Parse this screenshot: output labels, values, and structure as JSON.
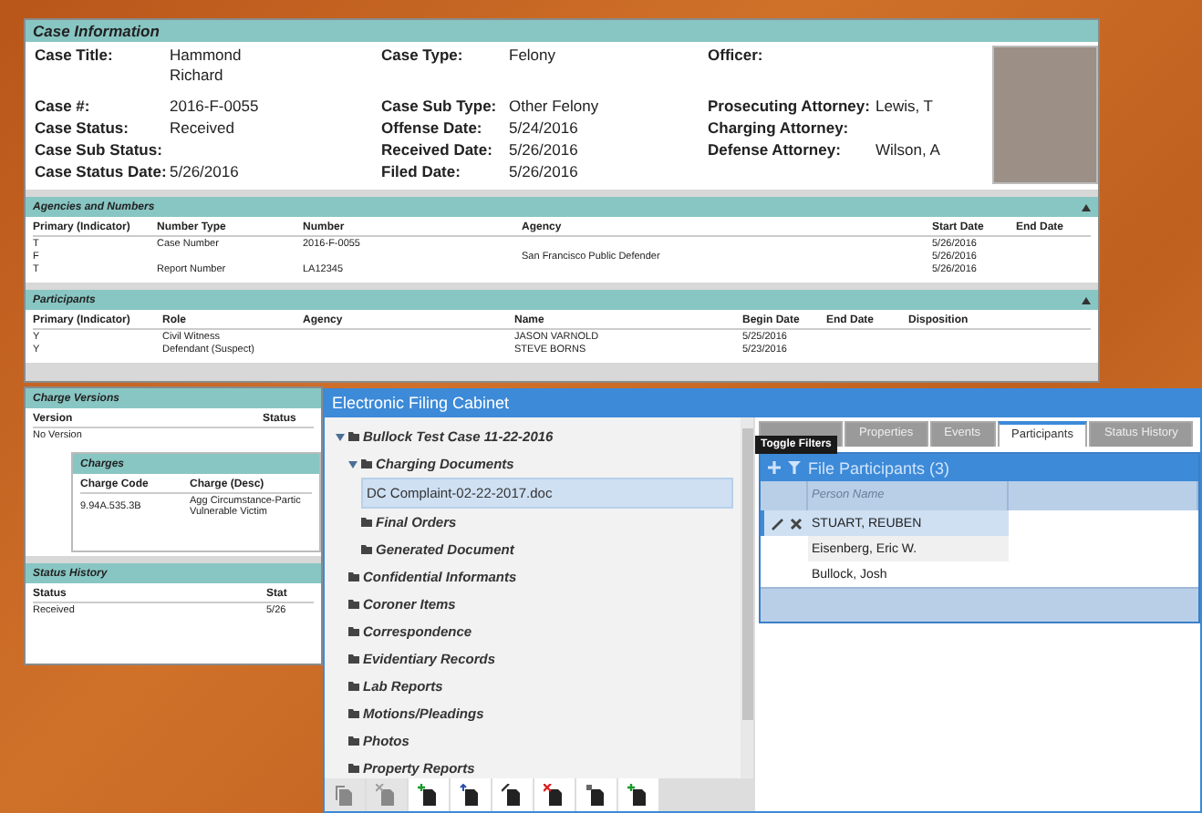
{
  "case_window": {
    "title": "Case Information",
    "fields": [
      [
        {
          "label": "Case Title:",
          "value": "Hammond\nRichard"
        },
        {
          "label": "Case Type:",
          "value": "Felony"
        },
        {
          "label": "Officer:"
        }
      ],
      [
        {
          "label": "Case #:",
          "value": "2016-F-0055"
        },
        {
          "label": "Case Sub Type:",
          "value": "Other Felony"
        },
        {
          "label": "Prosecuting Attorney:",
          "value": "Lewis, T"
        }
      ],
      [
        {
          "label": "Case Status:",
          "value": "Received"
        },
        {
          "label": "Offense Date:",
          "value": "5/24/2016"
        },
        {
          "label": "Charging Attorney:"
        }
      ],
      [
        {
          "label": "Case Sub Status:"
        },
        {
          "label": "Received Date:",
          "value": "5/26/2016"
        },
        {
          "label": "Defense Attorney:",
          "value": "Wilson, A"
        }
      ],
      [
        {
          "label": "Case Status Date:",
          "value": "5/26/2016"
        },
        {
          "label": "Filed Date:",
          "value": "5/26/2016"
        }
      ]
    ],
    "sections": [
      {
        "title": "Agencies and Numbers",
        "expanded": true,
        "columns": [
          "Primary (Indicator)",
          "Number Type",
          "Number",
          "Agency",
          "Start Date",
          "End Date"
        ],
        "rows": [
          [
            "T",
            "Case Number",
            "2016-F-0055",
            null,
            "5/26/2016",
            null
          ],
          [
            "F",
            null,
            null,
            "San Francisco Public Defender",
            "5/26/2016",
            null
          ],
          [
            "T",
            "Report Number",
            "LA12345",
            null,
            "5/26/2016",
            null
          ]
        ]
      },
      {
        "title": "Participants",
        "expanded": true,
        "columns": [
          "Primary (Indicator)",
          "Role",
          "Agency",
          "Name",
          "Begin Date",
          "End Date",
          "Disposition"
        ],
        "rows": [
          [
            "Y",
            "Civil Witness",
            null,
            "JASON VARNOLD",
            "5/25/2016",
            null,
            null
          ],
          [
            "Y",
            "Defendant (Suspect)",
            null,
            "STEVE BORNS",
            "5/23/2016",
            null,
            null
          ]
        ]
      }
    ]
  },
  "charge_panel": {
    "title": "Charge Versions",
    "columns": [
      "Version",
      "Status"
    ],
    "rows": [
      [
        "No Version"
      ]
    ],
    "charges": {
      "title": "Charges",
      "columns": [
        "Charge Code",
        "Charge (Desc)"
      ],
      "rows": [
        [
          "9.94A.535.3B",
          "Agg Circumstance-Partic\nVulnerable Victim"
        ]
      ]
    },
    "status_history": {
      "title": "Status History",
      "columns": [
        "Status",
        "Stat"
      ],
      "rows": [
        [
          "Received",
          "5/26"
        ]
      ]
    }
  },
  "filing_cabinet": {
    "title": "Electronic Filing Cabinet",
    "tree": [
      {
        "label": "Bullock Test Case 11-22-2016",
        "kind": "folder",
        "expanded": true,
        "selected": false,
        "children": [
          {
            "label": "Charging Documents",
            "kind": "folder",
            "expanded": true,
            "selected": false,
            "children": [
              {
                "label": "DC Complaint-02-22-2017.doc",
                "kind": "file",
                "selected": true
              },
              {
                "label": "Final Orders",
                "kind": "folder",
                "selected": false
              },
              {
                "label": "Generated Document",
                "kind": "folder",
                "selected": false
              }
            ]
          },
          {
            "label": "Confidential Informants",
            "kind": "folder",
            "selected": false
          },
          {
            "label": "Coroner Items",
            "kind": "folder",
            "selected": false
          },
          {
            "label": "Correspondence",
            "kind": "folder",
            "selected": false
          },
          {
            "label": "Evidentiary Records",
            "kind": "folder",
            "selected": false
          },
          {
            "label": "Lab Reports",
            "kind": "folder",
            "selected": false
          },
          {
            "label": "Motions/Pleadings",
            "kind": "folder",
            "selected": false
          },
          {
            "label": "Photos",
            "kind": "folder",
            "selected": false
          },
          {
            "label": "Property Reports",
            "kind": "folder",
            "selected": false
          }
        ]
      }
    ],
    "toolbar": [
      {
        "kind": "copy",
        "disabled": true
      },
      {
        "kind": "remove",
        "disabled": true
      },
      {
        "kind": "add",
        "disabled": false
      },
      {
        "kind": "upload",
        "disabled": false
      },
      {
        "kind": "edit",
        "disabled": false
      },
      {
        "kind": "delete",
        "disabled": false
      },
      {
        "kind": "move",
        "disabled": false
      },
      {
        "kind": "attach",
        "disabled": false
      }
    ],
    "tabs": [
      {
        "label": "Properties",
        "selected": false
      },
      {
        "label": "Events",
        "selected": false
      },
      {
        "label": "Participants",
        "selected": true
      },
      {
        "label": "Status History",
        "selected": false
      }
    ],
    "tooltip": "Toggle Filters",
    "participants": {
      "title": "File Participants (3)",
      "column": "Person Name",
      "rows": [
        {
          "name": "STUART, REUBEN",
          "selected": true
        },
        {
          "name": "Eisenberg, Eric W.",
          "selected": false
        },
        {
          "name": "Bullock, Josh",
          "selected": false
        }
      ]
    }
  }
}
